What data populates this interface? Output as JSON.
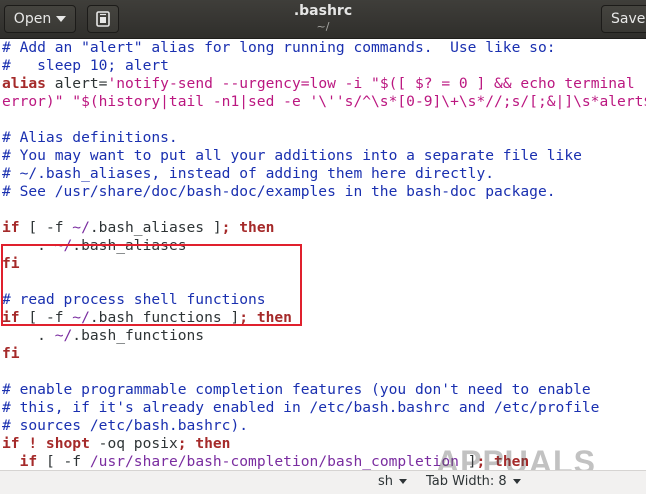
{
  "header": {
    "open_label": "Open",
    "title": ".bashrc",
    "subtitle": "~/",
    "save_label": "Save",
    "bookmark_icon": "document-bookmark-icon"
  },
  "editor": {
    "lines": [
      [
        {
          "t": "# Add an \"alert\" alias for long running commands.  Use like so:",
          "c": "comment"
        }
      ],
      [
        {
          "t": "#   sleep 10; alert",
          "c": "comment"
        }
      ],
      [
        {
          "t": "alias",
          "c": "kw"
        },
        {
          "t": " alert=",
          "c": "plain"
        },
        {
          "t": "'notify-send --urgency=low -i \"$([ $? = 0 ] && echo terminal ||",
          "c": "str"
        }
      ],
      [
        {
          "t": "error)\" \"$(history|tail -n1|sed -e '\\''s/^\\s*[0-9]\\+\\s*//;s/[;&|]\\s*alert$//'\\'')\"'",
          "c": "str"
        }
      ],
      [
        {
          "t": "",
          "c": "plain"
        }
      ],
      [
        {
          "t": "# Alias definitions.",
          "c": "comment"
        }
      ],
      [
        {
          "t": "# You may want to put all your additions into a separate file like",
          "c": "comment"
        }
      ],
      [
        {
          "t": "# ~/.bash_aliases, instead of adding them here directly.",
          "c": "comment"
        }
      ],
      [
        {
          "t": "# See /usr/share/doc/bash-doc/examples in the bash-doc package.",
          "c": "comment"
        }
      ],
      [
        {
          "t": "",
          "c": "plain"
        }
      ],
      [
        {
          "t": "if",
          "c": "kw"
        },
        {
          "t": " [ ",
          "c": "plain"
        },
        {
          "t": "-f",
          "c": "plain"
        },
        {
          "t": " ~/",
          "c": "path"
        },
        {
          "t": ".bash_aliases ]",
          "c": "plain"
        },
        {
          "t": "; then",
          "c": "kw"
        }
      ],
      [
        {
          "t": "    . ",
          "c": "plain"
        },
        {
          "t": "~/",
          "c": "path"
        },
        {
          "t": ".bash_aliases",
          "c": "plain"
        }
      ],
      [
        {
          "t": "fi",
          "c": "kw"
        }
      ],
      [
        {
          "t": "",
          "c": "plain"
        }
      ],
      [
        {
          "t": "# read process shell functions",
          "c": "comment"
        }
      ],
      [
        {
          "t": "if",
          "c": "kw"
        },
        {
          "t": " [ ",
          "c": "plain"
        },
        {
          "t": "-f",
          "c": "plain"
        },
        {
          "t": " ~/",
          "c": "path"
        },
        {
          "t": ".bash_functions ]",
          "c": "plain"
        },
        {
          "t": "; then",
          "c": "kw"
        }
      ],
      [
        {
          "t": "    . ",
          "c": "plain"
        },
        {
          "t": "~/",
          "c": "path"
        },
        {
          "t": ".bash_functions",
          "c": "plain"
        }
      ],
      [
        {
          "t": "fi",
          "c": "kw"
        }
      ],
      [
        {
          "t": "",
          "c": "plain"
        }
      ],
      [
        {
          "t": "# enable programmable completion features (you don't need to enable",
          "c": "comment"
        }
      ],
      [
        {
          "t": "# this, if it's already enabled in /etc/bash.bashrc and /etc/profile",
          "c": "comment"
        }
      ],
      [
        {
          "t": "# sources /etc/bash.bashrc).",
          "c": "comment"
        }
      ],
      [
        {
          "t": "if ! shopt",
          "c": "kw"
        },
        {
          "t": " -oq posix",
          "c": "plain"
        },
        {
          "t": "; then",
          "c": "kw"
        }
      ],
      [
        {
          "t": "  if",
          "c": "kw"
        },
        {
          "t": " [ ",
          "c": "plain"
        },
        {
          "t": "-f",
          "c": "plain"
        },
        {
          "t": " /usr/share/bash-completion/bash_completion",
          "c": "path"
        },
        {
          "t": " ]",
          "c": "plain"
        },
        {
          "t": "; then",
          "c": "kw"
        }
      ]
    ]
  },
  "colors": {
    "comment": "#1a30b0",
    "keyword": "#a52a2a",
    "string": "#bb1780",
    "highlight_box": "#e0202d"
  },
  "statusbar": {
    "language": "sh",
    "tab_width": "Tab Width: 8"
  },
  "watermark": "APPUALS"
}
